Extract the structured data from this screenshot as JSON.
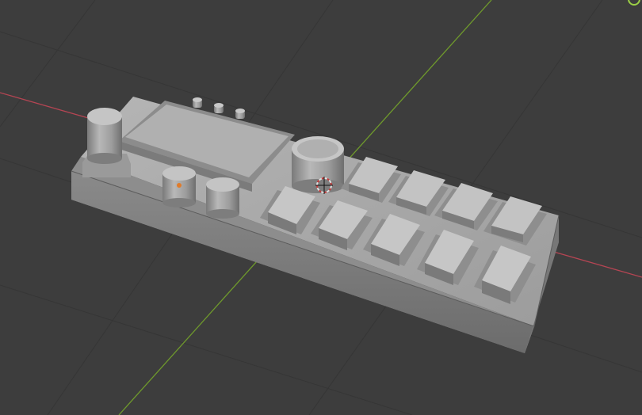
{
  "viewport": {
    "mode": "3d-viewport",
    "background": "#3d3d3d",
    "grid_line_color": "#363636",
    "x_axis_color": "#b54553",
    "y_axis_color": "#6f9a2c",
    "model_base_color": "#a6a6a6",
    "model_shadow_color": "#6f6f6f",
    "model_highlight_color": "#c8c8c8",
    "origin_color": "#e07b2a"
  },
  "gizmo": {
    "icon": "axis-gizmo-icon",
    "color": "#9bcf45"
  },
  "objects": {
    "base_plate": "base-plate",
    "screen": "screen-panel",
    "knobs": [
      "large-knob",
      "small-knob-1",
      "small-knob-2",
      "center-knob"
    ],
    "buttons_top_row": 4,
    "buttons_bottom_row": 5
  }
}
